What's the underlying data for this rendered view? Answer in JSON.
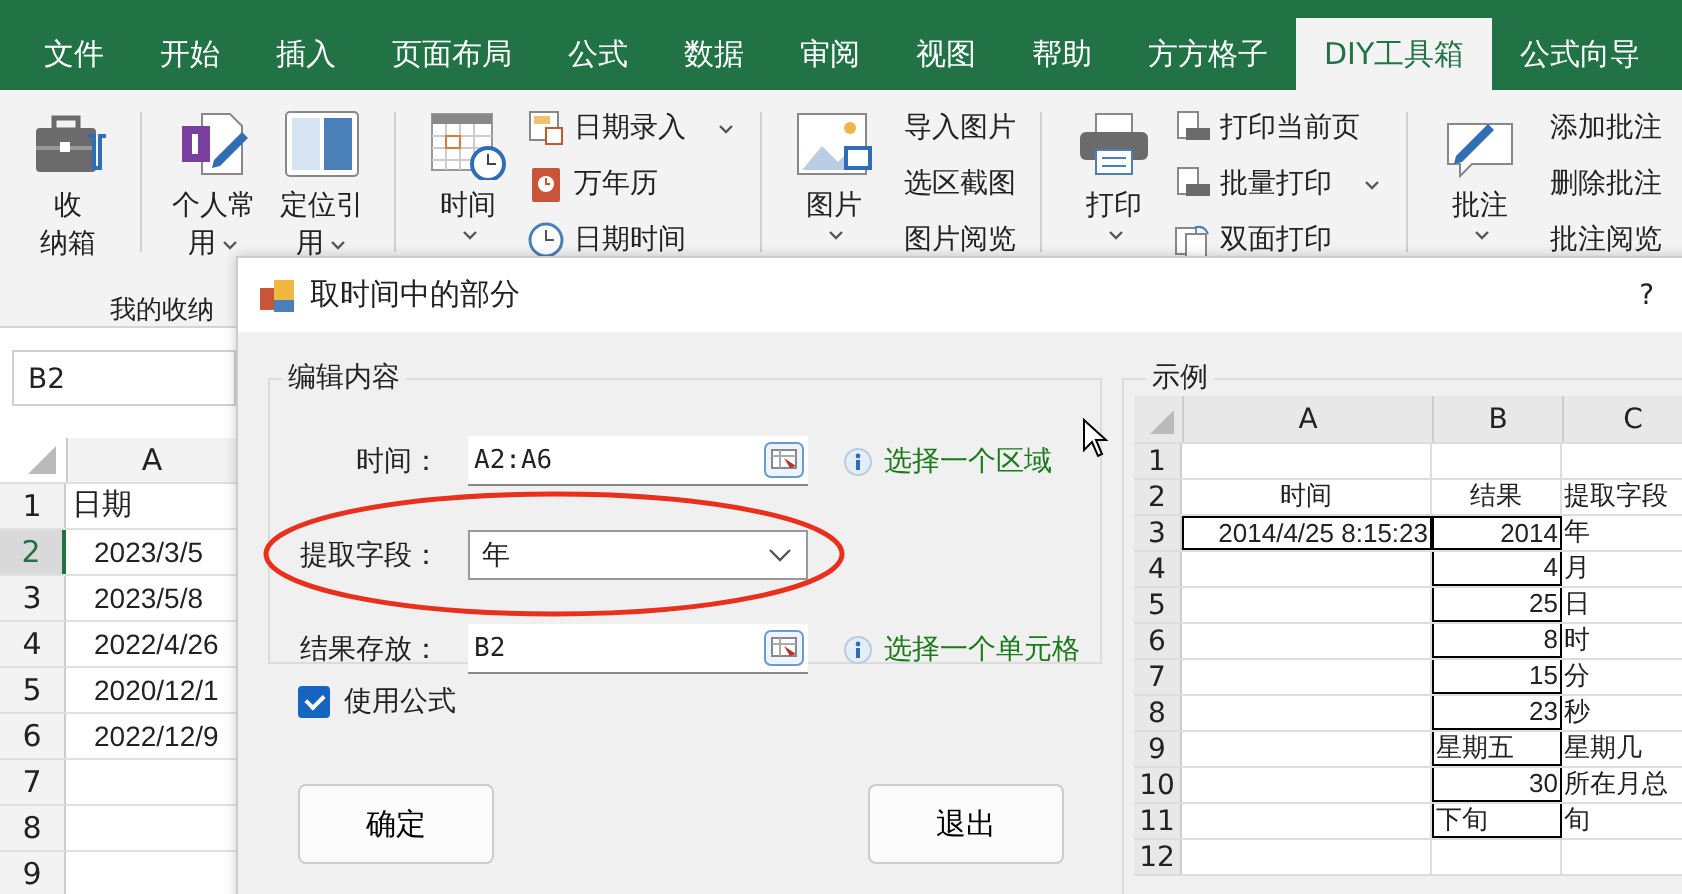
{
  "ribbon_tabs": [
    {
      "label": "文件",
      "selected": false
    },
    {
      "label": "开始",
      "selected": false
    },
    {
      "label": "插入",
      "selected": false
    },
    {
      "label": "页面布局",
      "selected": false
    },
    {
      "label": "公式",
      "selected": false
    },
    {
      "label": "数据",
      "selected": false
    },
    {
      "label": "审阅",
      "selected": false
    },
    {
      "label": "视图",
      "selected": false
    },
    {
      "label": "帮助",
      "selected": false
    },
    {
      "label": "方方格子",
      "selected": false
    },
    {
      "label": "DIY工具箱",
      "selected": true
    },
    {
      "label": "公式向导",
      "selected": false
    }
  ],
  "ribbon": {
    "groups": [
      {
        "items": [
          {
            "kind": "large",
            "lines": [
              "收",
              "纳箱"
            ],
            "dropdown": false
          }
        ]
      },
      {
        "items": [
          {
            "kind": "large",
            "lines": [
              "个人常",
              "用"
            ],
            "dropdown": true
          },
          {
            "kind": "large",
            "lines": [
              "定位引",
              "用"
            ],
            "dropdown": true
          }
        ]
      },
      {
        "items": [
          {
            "kind": "large",
            "lines": [
              "时间"
            ],
            "dropdown": true
          },
          {
            "kind": "column",
            "entries": [
              {
                "label": "日期录入",
                "dropdown": true
              },
              {
                "label": "万年历",
                "dropdown": false
              },
              {
                "label": "日期时间",
                "dropdown": false
              }
            ]
          }
        ]
      },
      {
        "items": [
          {
            "kind": "large",
            "lines": [
              "图片"
            ],
            "dropdown": true
          },
          {
            "kind": "column",
            "entries": [
              {
                "label": "导入图片",
                "dropdown": false
              },
              {
                "label": "选区截图",
                "dropdown": false
              },
              {
                "label": "图片阅览",
                "dropdown": false
              }
            ]
          }
        ]
      },
      {
        "items": [
          {
            "kind": "large",
            "lines": [
              "打印"
            ],
            "dropdown": true
          },
          {
            "kind": "column",
            "entries": [
              {
                "label": "打印当前页",
                "dropdown": false
              },
              {
                "label": "批量打印",
                "dropdown": true
              },
              {
                "label": "双面打印",
                "dropdown": false
              }
            ]
          }
        ]
      },
      {
        "items": [
          {
            "kind": "large",
            "lines": [
              "批注"
            ],
            "dropdown": true
          },
          {
            "kind": "column",
            "entries": [
              {
                "label": "添加批注",
                "dropdown": false
              },
              {
                "label": "删除批注",
                "dropdown": false
              },
              {
                "label": "批注阅览",
                "dropdown": false
              }
            ]
          }
        ]
      }
    ],
    "group_label": "我的收纳"
  },
  "sheet": {
    "name_box": "B2",
    "column": "A",
    "rows": [
      {
        "num": "1",
        "value": "日期",
        "kind": "text",
        "selected": false
      },
      {
        "num": "2",
        "value": "2023/3/5",
        "kind": "number",
        "selected": true
      },
      {
        "num": "3",
        "value": "2023/5/8",
        "kind": "number",
        "selected": false
      },
      {
        "num": "4",
        "value": "2022/4/26",
        "kind": "number",
        "selected": false
      },
      {
        "num": "5",
        "value": "2020/12/1",
        "kind": "number",
        "selected": false
      },
      {
        "num": "6",
        "value": "2022/12/9",
        "kind": "number",
        "selected": false
      },
      {
        "num": "7",
        "selected": false
      },
      {
        "num": "8",
        "selected": false
      },
      {
        "num": "9",
        "selected": false
      }
    ]
  },
  "dialog": {
    "title": "取时间中的部分",
    "help": "?",
    "edit_group": {
      "legend": "编辑内容",
      "fields": [
        {
          "kind": "range",
          "label": "时间：",
          "value": "A2:A6",
          "hint": "选择一个区域",
          "highlighted": false
        },
        {
          "kind": "select",
          "label": "提取字段：",
          "value": "年",
          "highlighted": true
        },
        {
          "kind": "range",
          "label": "结果存放：",
          "value": "B2",
          "hint": "选择一个单元格",
          "highlighted": false
        }
      ]
    },
    "use_formula": {
      "label": "使用公式",
      "checked": true
    },
    "buttons": [
      "确定",
      "退出"
    ],
    "example": {
      "legend": "示例",
      "columns": [
        "A",
        "B",
        "C"
      ],
      "rows": [
        {
          "num": "1",
          "cells": {}
        },
        {
          "num": "2",
          "cells": {
            "a": {
              "text": "时间",
              "kind": "header",
              "boxed": false
            },
            "b": {
              "text": "结果",
              "kind": "header",
              "boxed": false
            },
            "c": {
              "text": "提取字段",
              "kind": "text",
              "boxed": false
            }
          }
        },
        {
          "num": "3",
          "cells": {
            "a": {
              "text": "2014/4/25 8:15:23",
              "kind": "number",
              "boxed": true
            },
            "b": {
              "text": "2014",
              "kind": "number",
              "boxed": true
            },
            "c": {
              "text": "年",
              "kind": "text",
              "boxed": false
            }
          }
        },
        {
          "num": "4",
          "cells": {
            "b": {
              "text": "4",
              "kind": "number",
              "boxed": true
            },
            "c": {
              "text": "月",
              "kind": "text",
              "boxed": false
            }
          }
        },
        {
          "num": "5",
          "cells": {
            "b": {
              "text": "25",
              "kind": "number",
              "boxed": true
            },
            "c": {
              "text": "日",
              "kind": "text",
              "boxed": false
            }
          }
        },
        {
          "num": "6",
          "cells": {
            "b": {
              "text": "8",
              "kind": "number",
              "boxed": true
            },
            "c": {
              "text": "时",
              "kind": "text",
              "boxed": false
            }
          }
        },
        {
          "num": "7",
          "cells": {
            "b": {
              "text": "15",
              "kind": "number",
              "boxed": true
            },
            "c": {
              "text": "分",
              "kind": "text",
              "boxed": false
            }
          }
        },
        {
          "num": "8",
          "cells": {
            "b": {
              "text": "23",
              "kind": "number",
              "boxed": true
            },
            "c": {
              "text": "秒",
              "kind": "text",
              "boxed": false
            }
          }
        },
        {
          "num": "9",
          "cells": {
            "b": {
              "text": "星期五",
              "kind": "text",
              "boxed": true
            },
            "c": {
              "text": "星期几",
              "kind": "text",
              "boxed": false
            }
          }
        },
        {
          "num": "10",
          "cells": {
            "b": {
              "text": "30",
              "kind": "number",
              "boxed": true
            },
            "c": {
              "text": "所在月总",
              "kind": "text",
              "boxed": false
            }
          }
        },
        {
          "num": "11",
          "cells": {
            "b": {
              "text": "下旬",
              "kind": "text",
              "boxed": true
            },
            "c": {
              "text": "旬",
              "kind": "text",
              "boxed": false
            }
          }
        },
        {
          "num": "12",
          "cells": {}
        }
      ]
    }
  }
}
